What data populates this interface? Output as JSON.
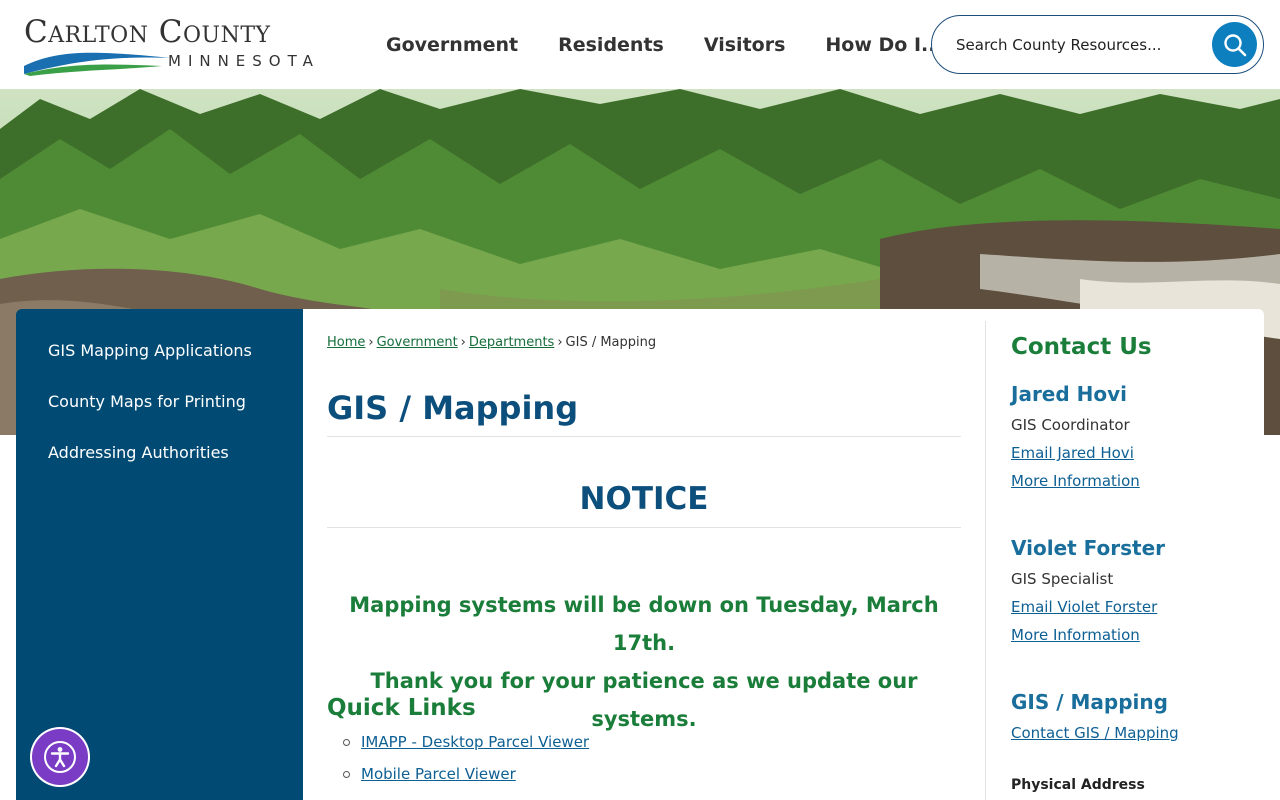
{
  "logo": {
    "title": "Carlton County",
    "subtitle": "MINNESOTA"
  },
  "nav": [
    {
      "label": "Government"
    },
    {
      "label": "Residents"
    },
    {
      "label": "Visitors"
    },
    {
      "label": "How Do I..."
    }
  ],
  "search": {
    "placeholder": "Search County Resources..."
  },
  "sidebar": {
    "items": [
      {
        "label": "GIS Mapping Applications"
      },
      {
        "label": "County Maps for Printing"
      },
      {
        "label": "Addressing Authorities"
      }
    ]
  },
  "breadcrumb": {
    "home": "Home",
    "government": "Government",
    "departments": "Departments",
    "current": "GIS / Mapping",
    "separator": "›"
  },
  "main": {
    "title": "GIS / Mapping",
    "notice_heading": "NOTICE",
    "notice_line1": "Mapping systems will be down on Tuesday, March 17th.",
    "notice_line2": "Thank you for your patience as we update our systems.",
    "quick_links_title": "Quick Links",
    "quick_links": [
      {
        "label": "IMAPP - Desktop Parcel Viewer"
      },
      {
        "label": "Mobile Parcel Viewer"
      }
    ]
  },
  "contact": {
    "title": "Contact Us",
    "people": [
      {
        "name": "Jared Hovi",
        "role": "GIS Coordinator",
        "email_label": "Email Jared Hovi",
        "more_label": "More Information"
      },
      {
        "name": "Violet Forster",
        "role": "GIS Specialist",
        "email_label": "Email Violet Forster",
        "more_label": "More Information"
      }
    ],
    "dept_name": "GIS / Mapping",
    "dept_link": "Contact GIS / Mapping",
    "address_label": "Physical Address"
  },
  "colors": {
    "navy": "#004a74",
    "title_blue": "#0d4f7c",
    "green": "#1b7d3a",
    "search_blue": "#0d7fbf",
    "accessibility_purple": "#7b3cc5"
  },
  "icons": {
    "search": "search-icon",
    "accessibility": "accessibility-icon"
  }
}
